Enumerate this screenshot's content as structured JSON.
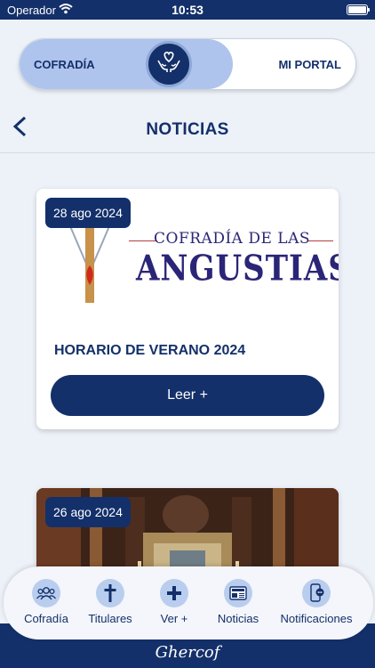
{
  "status_bar": {
    "carrier": "Operador",
    "time": "10:53"
  },
  "toggle": {
    "left_label": "COFRADÍA",
    "right_label": "MI PORTAL",
    "active": "left"
  },
  "header": {
    "title": "NOTICIAS"
  },
  "news": [
    {
      "date": "28 ago 2024",
      "logo_line1": "COFRADÍA DE LAS",
      "logo_line2": "ANGUSTIAS",
      "title": "HORARIO DE VERANO 2024",
      "button_label": "Leer +"
    },
    {
      "date": "26 ago 2024"
    }
  ],
  "tabbar": {
    "items": [
      {
        "label": "Cofradía",
        "icon": "group-icon"
      },
      {
        "label": "Titulares",
        "icon": "cross-icon"
      },
      {
        "label": "Ver +",
        "icon": "plus-icon"
      },
      {
        "label": "Noticias",
        "icon": "newspaper-icon"
      },
      {
        "label": "Notificaciones",
        "icon": "phone-chat-icon"
      }
    ]
  },
  "footer": {
    "brand": "Ghercof"
  },
  "colors": {
    "primary": "#14306a",
    "accent": "#aec4ec",
    "background": "#edf1f8"
  }
}
